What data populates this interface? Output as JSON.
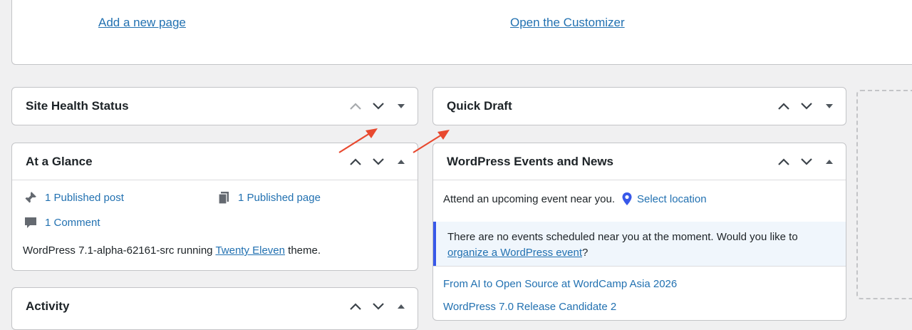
{
  "top_panel": {
    "add_page_link": "Add a new page",
    "customizer_link": "Open the Customizer"
  },
  "site_health": {
    "title": "Site Health Status"
  },
  "quick_draft": {
    "title": "Quick Draft"
  },
  "glance": {
    "title": "At a Glance",
    "posts": "1 Published post",
    "pages": "1 Published page",
    "comments": "1 Comment",
    "footer_prefix": "WordPress 7.1-alpha-62161-src running ",
    "theme_link": "Twenty Eleven",
    "footer_suffix": " theme."
  },
  "activity": {
    "title": "Activity"
  },
  "events": {
    "title": "WordPress Events and News",
    "attend_text": "Attend an upcoming event near you.",
    "select_location": "Select location",
    "notice_text": "There are no events scheduled near you at the moment. Would you like to ",
    "notice_link": "organize a WordPress event",
    "notice_suffix": "?",
    "news_items": [
      "From AI to Open Source at WordCamp Asia 2026",
      "WordPress 7.0 Release Candidate 2"
    ]
  },
  "colors": {
    "link": "#2271b1",
    "arrow": "#e8492f",
    "notice_border": "#3858e9"
  }
}
